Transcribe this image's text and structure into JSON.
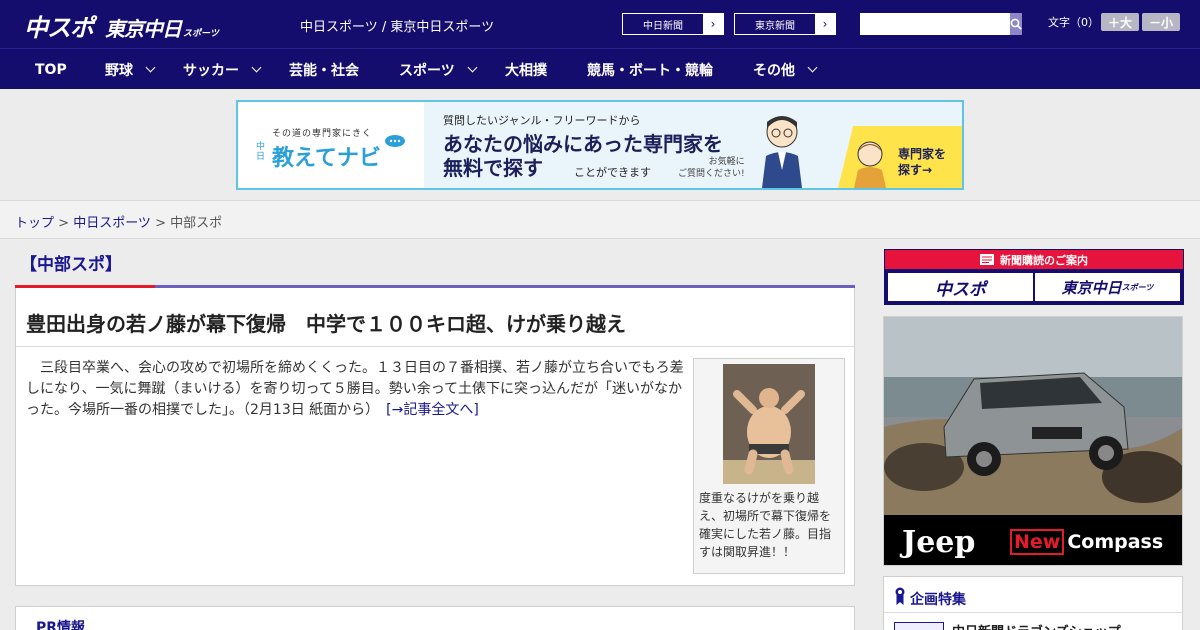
{
  "header": {
    "logo_main": "中スポ",
    "logo_tokyo": "東京中日",
    "logo_tokyo_suffix": "スポーツ",
    "site_name": "中日スポーツ / 東京中日スポーツ",
    "paper_links": [
      "中日新聞",
      "東京新聞"
    ],
    "font_size_label": "文字（0）",
    "font_larger": "＋大",
    "font_smaller": "－小"
  },
  "nav": {
    "items": [
      {
        "label": "TOP",
        "dropdown": false
      },
      {
        "label": "野球",
        "dropdown": true
      },
      {
        "label": "サッカー",
        "dropdown": true
      },
      {
        "label": "芸能・社会",
        "dropdown": false
      },
      {
        "label": "スポーツ",
        "dropdown": true
      },
      {
        "label": "大相撲",
        "dropdown": false
      },
      {
        "label": "競馬・ボート・競輪",
        "dropdown": false
      },
      {
        "label": "その他",
        "dropdown": true
      }
    ]
  },
  "banner": {
    "tagline": "その道の専門家にきく",
    "brand_prefix": "中日",
    "brand": "教えてナビ",
    "question": "質問したいジャンル・フリーワードから",
    "headline1": "あなたの悩みにあった専門家を",
    "headline2": "無料で探す",
    "headline2_suffix": "ことができます",
    "note_line1": "お気軽に",
    "note_line2": "ご質問ください!",
    "cta_line1": "専門家を",
    "cta_line2": "探す→"
  },
  "breadcrumb": {
    "home": "トップ",
    "sep": " > ",
    "section": "中日スポーツ",
    "current": "中部スポ"
  },
  "section": {
    "title": "【中部スポ】"
  },
  "article": {
    "headline": "豊田出身の若ノ藤が幕下復帰　中学で１００キロ超、けが乗り越え",
    "body": "三段目卒業へ、会心の攻めで初場所を締めくくった。１３日目の７番相撲、若ノ藤が立ち合いでもろ差しになり、一気に舞蹴（まいける）を寄り切って５勝目。勢い余って土俵下に突っ込んだが「迷いがなかった。今場所一番の相撲でした」。（2月13日 紙面から）　",
    "more_link": "[→記事全文へ]",
    "photo_caption": "度重なるけがを乗り越え、初場所で幕下復帰を確実にした若ノ藤。目指すは関取昇進！！"
  },
  "pr": {
    "title": "PR情報"
  },
  "sidebar": {
    "subscribe_title": "新聞購読のご案内",
    "subscribe_btn1": "中スポ",
    "subscribe_btn2": "東京中日",
    "subscribe_btn2_suffix": "スポーツ",
    "ad_brand": "Jeep",
    "ad_new": "New",
    "ad_model": "Compass",
    "feature_title": "企画特集",
    "feature_item": "中日新聞ドラゴンズショップ"
  },
  "colors": {
    "brand_navy": "#150d6e",
    "accent_red": "#e51a2a",
    "link_blue": "#1a1890"
  }
}
